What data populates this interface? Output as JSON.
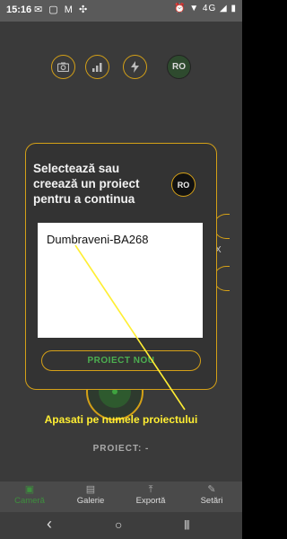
{
  "status_bar": {
    "time": "15:16",
    "notification_icons": "✉ ▢ M ✣",
    "system_icons": "⏰ ▼ 4G ◢ ▮"
  },
  "camera": {
    "top_buttons": [
      {
        "icon": "camera-icon",
        "glyph": "📷"
      },
      {
        "icon": "signal-bars-icon",
        "glyph": "▂▄▆"
      },
      {
        "icon": "flash-icon",
        "glyph": "⚡"
      }
    ],
    "lang_button": "RO",
    "side_marker": "X",
    "project_label": "PROIECT: -"
  },
  "dialog": {
    "title": "Selectează sau creează un proiect pentru a continua",
    "lang_button": "RO",
    "projects": [
      "Dumbraveni-BA268"
    ],
    "new_project_button": "PROIECT NOU"
  },
  "annotation": {
    "hint": "Apasati pe numele proiectului",
    "color": "#ffee33"
  },
  "tabs": [
    {
      "label": "Cameră",
      "icon": "camera-tab-icon",
      "glyph": "▣",
      "active": true
    },
    {
      "label": "Galerie",
      "icon": "gallery-icon",
      "glyph": "▤",
      "active": false
    },
    {
      "label": "Exportă",
      "icon": "export-icon",
      "glyph": "⤒",
      "active": false
    },
    {
      "label": "Setări",
      "icon": "settings-icon",
      "glyph": "✎",
      "active": false
    }
  ],
  "nav": {
    "back": "‹",
    "home": "○",
    "recents": "|||"
  },
  "colors": {
    "accent": "#d4a017",
    "active_green": "#3e8f3e",
    "button_text_green": "#4caf50"
  }
}
